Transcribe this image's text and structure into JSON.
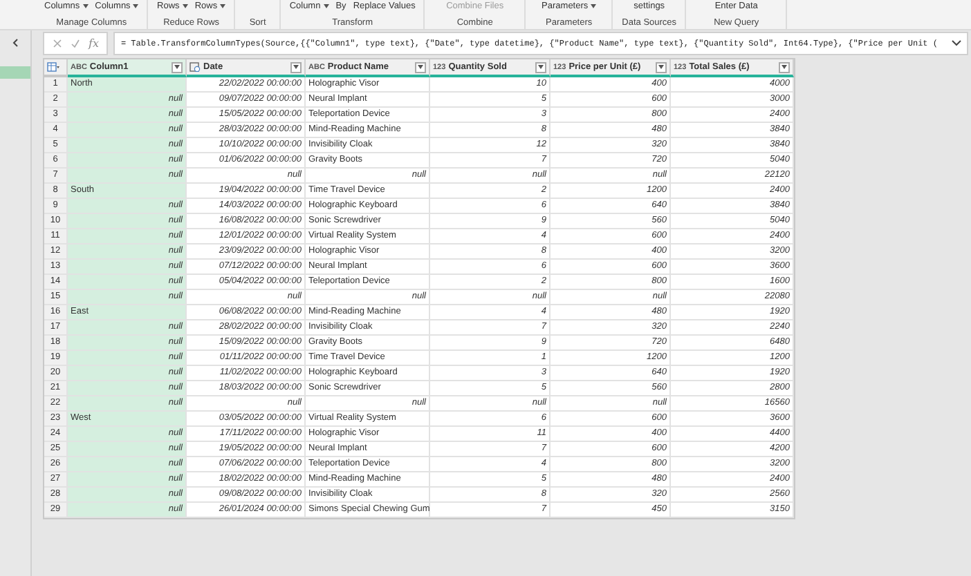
{
  "ribbon": {
    "groups": [
      {
        "label": "Manage Columns",
        "items": [
          {
            "text": "Columns",
            "dropdown": true,
            "disabled": false
          },
          {
            "text": "Columns",
            "dropdown": true,
            "disabled": false
          }
        ]
      },
      {
        "label": "Reduce Rows",
        "items": [
          {
            "text": "Rows",
            "dropdown": true,
            "disabled": false
          },
          {
            "text": "Rows",
            "dropdown": true,
            "disabled": false
          }
        ]
      },
      {
        "label": "Sort"
      },
      {
        "label": "Transform",
        "items": [
          {
            "text": "Column",
            "dropdown": true,
            "disabled": false
          },
          {
            "text": "By",
            "dropdown": false,
            "disabled": false
          },
          {
            "text": "Replace Values",
            "dropdown": false,
            "disabled": false
          }
        ]
      },
      {
        "label": "Combine",
        "items": [
          {
            "text": "Combine Files",
            "dropdown": false,
            "disabled": true
          }
        ]
      },
      {
        "label": "Parameters",
        "items": [
          {
            "text": "Parameters",
            "dropdown": true,
            "disabled": false
          }
        ]
      },
      {
        "label": "Data Sources",
        "items": [
          {
            "text": "settings",
            "dropdown": false,
            "disabled": false
          }
        ]
      },
      {
        "label": "New Query",
        "items": [
          {
            "text": "Enter Data",
            "dropdown": false,
            "disabled": false
          }
        ]
      }
    ]
  },
  "fx_label": "fx",
  "formula": "= Table.TransformColumnTypes(Source,{{\"Column1\", type text}, {\"Date\", type datetime}, {\"Product Name\", type text}, {\"Quantity Sold\", Int64.Type}, {\"Price per Unit (",
  "table": {
    "columns": [
      {
        "name": "Column1",
        "kind": "text",
        "type_label": "ABC",
        "selected": true
      },
      {
        "name": "Date",
        "kind": "date",
        "selected": false
      },
      {
        "name": "Product Name",
        "kind": "text",
        "type_label": "ABC",
        "selected": false
      },
      {
        "name": "Quantity Sold",
        "kind": "number",
        "type_label": "123",
        "selected": false
      },
      {
        "name": "Price per Unit (£)",
        "kind": "number",
        "type_label": "123",
        "selected": false
      },
      {
        "name": "Total Sales (£)",
        "kind": "number",
        "type_label": "123",
        "selected": false
      }
    ],
    "rows": [
      {
        "n": "1",
        "kind": "group",
        "cells": [
          "North",
          "22/02/2022 00:00:00",
          "Holographic Visor",
          "10",
          "400",
          "4000"
        ]
      },
      {
        "n": "2",
        "kind": "item",
        "cells": [
          "null",
          "09/07/2022 00:00:00",
          "Neural Implant",
          "5",
          "600",
          "3000"
        ]
      },
      {
        "n": "3",
        "kind": "item",
        "cells": [
          "null",
          "15/05/2022 00:00:00",
          "Teleportation Device",
          "3",
          "800",
          "2400"
        ]
      },
      {
        "n": "4",
        "kind": "item",
        "cells": [
          "null",
          "28/03/2022 00:00:00",
          "Mind-Reading Machine",
          "8",
          "480",
          "3840"
        ]
      },
      {
        "n": "5",
        "kind": "item",
        "cells": [
          "null",
          "10/10/2022 00:00:00",
          "Invisibility Cloak",
          "12",
          "320",
          "3840"
        ]
      },
      {
        "n": "6",
        "kind": "item",
        "cells": [
          "null",
          "01/06/2022 00:00:00",
          "Gravity Boots",
          "7",
          "720",
          "5040"
        ]
      },
      {
        "n": "7",
        "kind": "total",
        "cells": [
          "null",
          "null",
          "null",
          "null",
          "null",
          "22120"
        ]
      },
      {
        "n": "8",
        "kind": "group",
        "cells": [
          "South",
          "19/04/2022 00:00:00",
          "Time Travel Device",
          "2",
          "1200",
          "2400"
        ]
      },
      {
        "n": "9",
        "kind": "item",
        "cells": [
          "null",
          "14/03/2022 00:00:00",
          "Holographic Keyboard",
          "6",
          "640",
          "3840"
        ]
      },
      {
        "n": "10",
        "kind": "item",
        "cells": [
          "null",
          "16/08/2022 00:00:00",
          "Sonic Screwdriver",
          "9",
          "560",
          "5040"
        ]
      },
      {
        "n": "11",
        "kind": "item",
        "cells": [
          "null",
          "12/01/2022 00:00:00",
          "Virtual Reality System",
          "4",
          "600",
          "2400"
        ]
      },
      {
        "n": "12",
        "kind": "item",
        "cells": [
          "null",
          "23/09/2022 00:00:00",
          "Holographic Visor",
          "8",
          "400",
          "3200"
        ]
      },
      {
        "n": "13",
        "kind": "item",
        "cells": [
          "null",
          "07/12/2022 00:00:00",
          "Neural Implant",
          "6",
          "600",
          "3600"
        ]
      },
      {
        "n": "14",
        "kind": "item",
        "cells": [
          "null",
          "05/04/2022 00:00:00",
          "Teleportation Device",
          "2",
          "800",
          "1600"
        ]
      },
      {
        "n": "15",
        "kind": "total",
        "cells": [
          "null",
          "null",
          "null",
          "null",
          "null",
          "22080"
        ]
      },
      {
        "n": "16",
        "kind": "group",
        "cells": [
          "East",
          "06/08/2022 00:00:00",
          "Mind-Reading Machine",
          "4",
          "480",
          "1920"
        ]
      },
      {
        "n": "17",
        "kind": "item",
        "cells": [
          "null",
          "28/02/2022 00:00:00",
          "Invisibility Cloak",
          "7",
          "320",
          "2240"
        ]
      },
      {
        "n": "18",
        "kind": "item",
        "cells": [
          "null",
          "15/09/2022 00:00:00",
          "Gravity Boots",
          "9",
          "720",
          "6480"
        ]
      },
      {
        "n": "19",
        "kind": "item",
        "cells": [
          "null",
          "01/11/2022 00:00:00",
          "Time Travel Device",
          "1",
          "1200",
          "1200"
        ]
      },
      {
        "n": "20",
        "kind": "item",
        "cells": [
          "null",
          "11/02/2022 00:00:00",
          "Holographic Keyboard",
          "3",
          "640",
          "1920"
        ]
      },
      {
        "n": "21",
        "kind": "item",
        "cells": [
          "null",
          "18/03/2022 00:00:00",
          "Sonic Screwdriver",
          "5",
          "560",
          "2800"
        ]
      },
      {
        "n": "22",
        "kind": "total",
        "cells": [
          "null",
          "null",
          "null",
          "null",
          "null",
          "16560"
        ]
      },
      {
        "n": "23",
        "kind": "group",
        "cells": [
          "West",
          "03/05/2022 00:00:00",
          "Virtual Reality System",
          "6",
          "600",
          "3600"
        ]
      },
      {
        "n": "24",
        "kind": "item",
        "cells": [
          "null",
          "17/11/2022 00:00:00",
          "Holographic Visor",
          "11",
          "400",
          "4400"
        ]
      },
      {
        "n": "25",
        "kind": "item",
        "cells": [
          "null",
          "19/05/2022 00:00:00",
          "Neural Implant",
          "7",
          "600",
          "4200"
        ]
      },
      {
        "n": "26",
        "kind": "item",
        "cells": [
          "null",
          "07/06/2022 00:00:00",
          "Teleportation Device",
          "4",
          "800",
          "3200"
        ]
      },
      {
        "n": "27",
        "kind": "item",
        "cells": [
          "null",
          "18/02/2022 00:00:00",
          "Mind-Reading Machine",
          "5",
          "480",
          "2400"
        ]
      },
      {
        "n": "28",
        "kind": "item",
        "cells": [
          "null",
          "09/08/2022 00:00:00",
          "Invisibility Cloak",
          "8",
          "320",
          "2560"
        ]
      },
      {
        "n": "29",
        "kind": "item",
        "cells": [
          "null",
          "26/01/2024 00:00:00",
          "Simons Special Chewing Gum",
          "7",
          "450",
          "3150"
        ]
      }
    ]
  }
}
